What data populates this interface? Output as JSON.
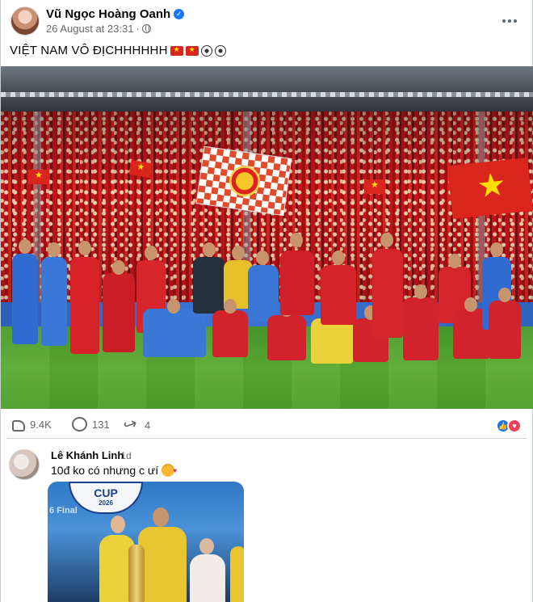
{
  "post": {
    "author": "Vũ Ngọc Hoàng Oanh",
    "verified_badge": "verified-badge-icon",
    "timestamp": "26 August at 23:31",
    "separator": "·",
    "privacy_icon": "globe-icon",
    "more_icon": "more-options-icon",
    "caption_text": "VIỆT NAM VÔ ĐỊCHHHHHH",
    "caption_emojis": [
      "vietnam-flag",
      "vietnam-flag",
      "soccer-ball",
      "soccer-ball"
    ]
  },
  "stats": {
    "likes": "9.4K",
    "comments": "131",
    "shares": "4",
    "reactions": [
      "like",
      "love"
    ]
  },
  "comment": {
    "author": "Lê Khánh Linh",
    "time": "· 1d",
    "text": "10đ ko có nhưng c ưí",
    "emoji": "smiling-face-with-hearts",
    "photo_badge": {
      "title": "CUP",
      "year": "2026",
      "subtitle": "6 Final"
    }
  },
  "colors": {
    "accent": "#1877f2",
    "love": "#f33e58",
    "muted_text": "#65676b",
    "vietnam_red": "#da251d",
    "vietnam_yellow": "#ffde00"
  }
}
